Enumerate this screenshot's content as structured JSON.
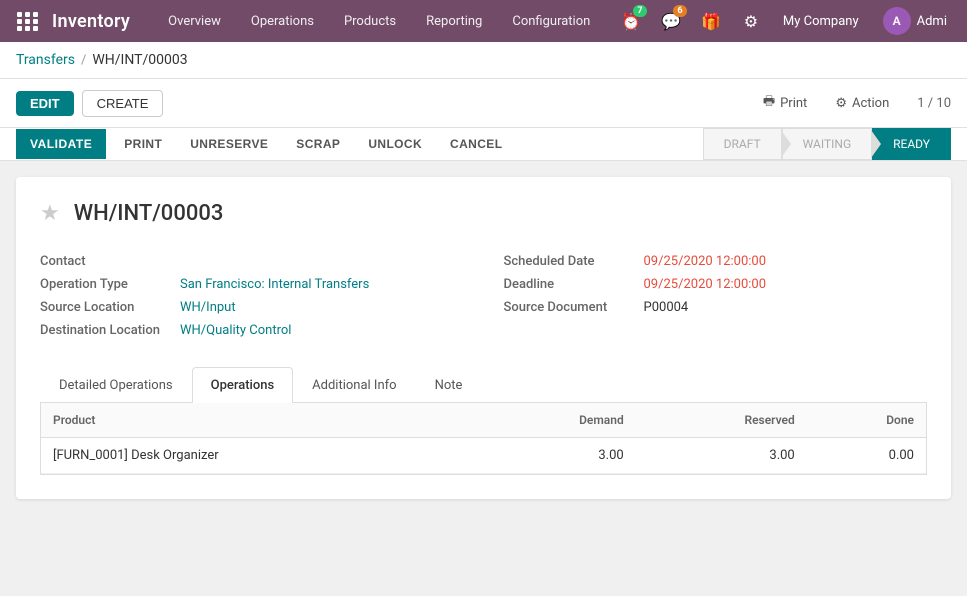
{
  "navbar": {
    "brand": "Inventory",
    "menu_items": [
      "Overview",
      "Operations",
      "Products",
      "Reporting",
      "Configuration"
    ],
    "notifications": [
      {
        "icon": "clock-icon",
        "count": "7",
        "badge_type": "green"
      },
      {
        "icon": "chat-icon",
        "count": "6",
        "badge_type": "orange"
      }
    ],
    "company": "My Company",
    "user": "Admi"
  },
  "breadcrumb": {
    "parent": "Transfers",
    "current": "WH/INT/00003"
  },
  "action_bar": {
    "edit_label": "EDIT",
    "create_label": "CREATE",
    "print_label": "Print",
    "action_label": "Action",
    "page_counter": "1 / 10"
  },
  "status_bar": {
    "validate_label": "VALIDATE",
    "print_label": "PRINT",
    "unreserve_label": "UNRESERVE",
    "scrap_label": "SCRAP",
    "unlock_label": "UNLOCK",
    "cancel_label": "CANCEL",
    "steps": [
      "DRAFT",
      "WAITING",
      "READY"
    ]
  },
  "form": {
    "title": "WH/INT/00003",
    "fields_left": [
      {
        "label": "Contact",
        "value": "",
        "type": "text"
      },
      {
        "label": "Operation Type",
        "value": "San Francisco: Internal Transfers",
        "type": "link"
      },
      {
        "label": "Source Location",
        "value": "WH/Input",
        "type": "link"
      },
      {
        "label": "Destination Location",
        "value": "WH/Quality Control",
        "type": "link"
      }
    ],
    "fields_right": [
      {
        "label": "Scheduled Date",
        "value": "09/25/2020 12:00:00",
        "type": "date-red"
      },
      {
        "label": "Deadline",
        "value": "09/25/2020 12:00:00",
        "type": "date-red"
      },
      {
        "label": "Source Document",
        "value": "P00004",
        "type": "text"
      }
    ]
  },
  "tabs": [
    {
      "label": "Detailed Operations",
      "active": false
    },
    {
      "label": "Operations",
      "active": true
    },
    {
      "label": "Additional Info",
      "active": false
    },
    {
      "label": "Note",
      "active": false
    }
  ],
  "table": {
    "columns": [
      "Product",
      "Demand",
      "Reserved",
      "Done"
    ],
    "rows": [
      {
        "product": "[FURN_0001] Desk Organizer",
        "demand": "3.00",
        "reserved": "3.00",
        "done": "0.00"
      }
    ]
  }
}
